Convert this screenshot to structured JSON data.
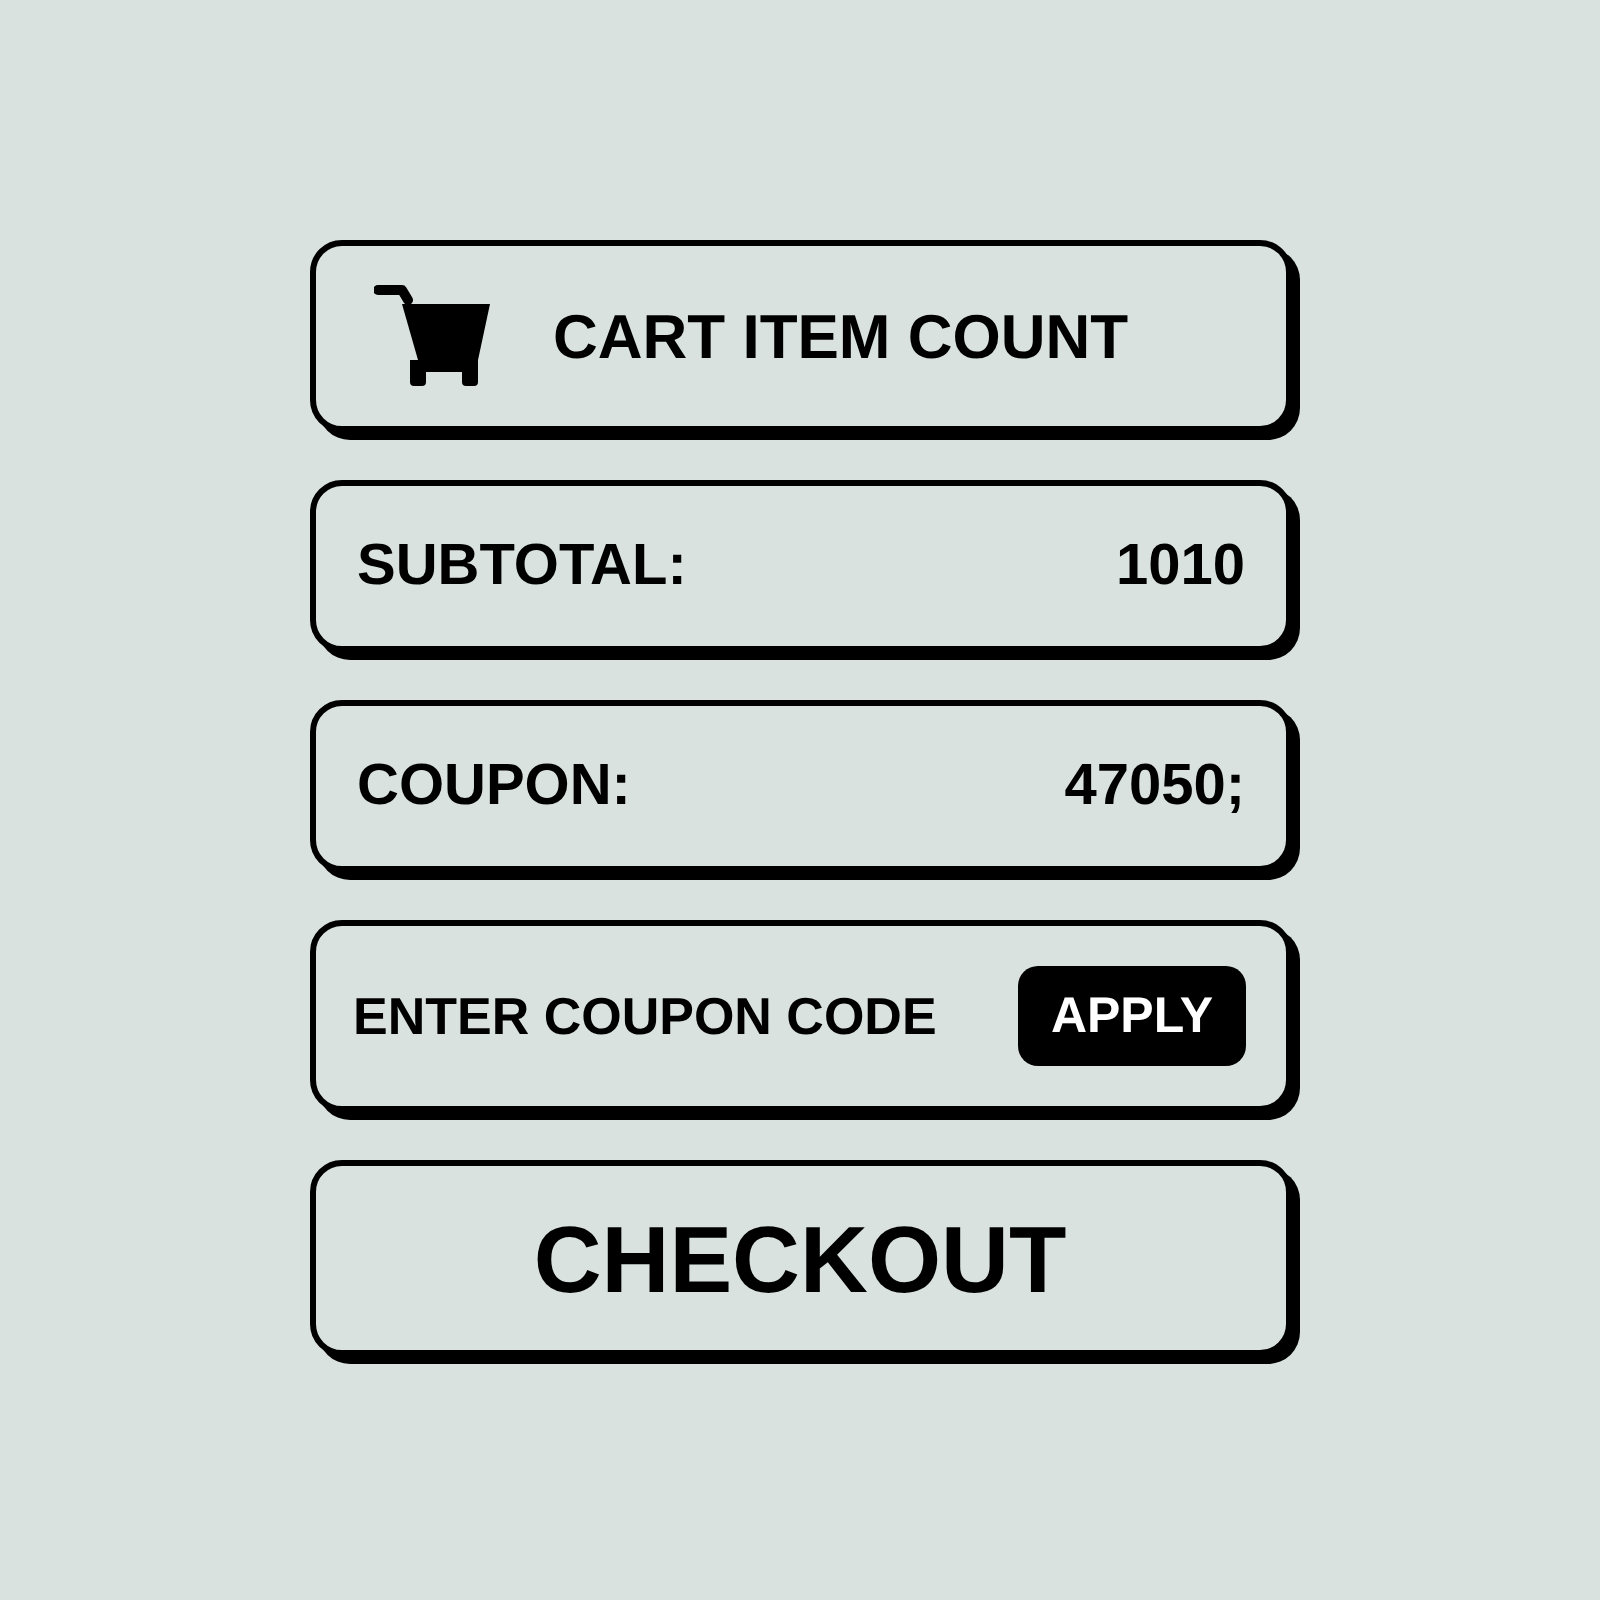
{
  "cart_header": {
    "label": "CART ITEM COUNT"
  },
  "summary_rows": [
    {
      "label": "SUBTOTAL:",
      "value": "1010"
    },
    {
      "label": "COUPON:",
      "value": "47050;"
    }
  ],
  "coupon_entry": {
    "placeholder": "ENTER COUPON CODE",
    "apply_button": "APPLY"
  },
  "checkout_button": {
    "label": "CHECKOUT"
  }
}
